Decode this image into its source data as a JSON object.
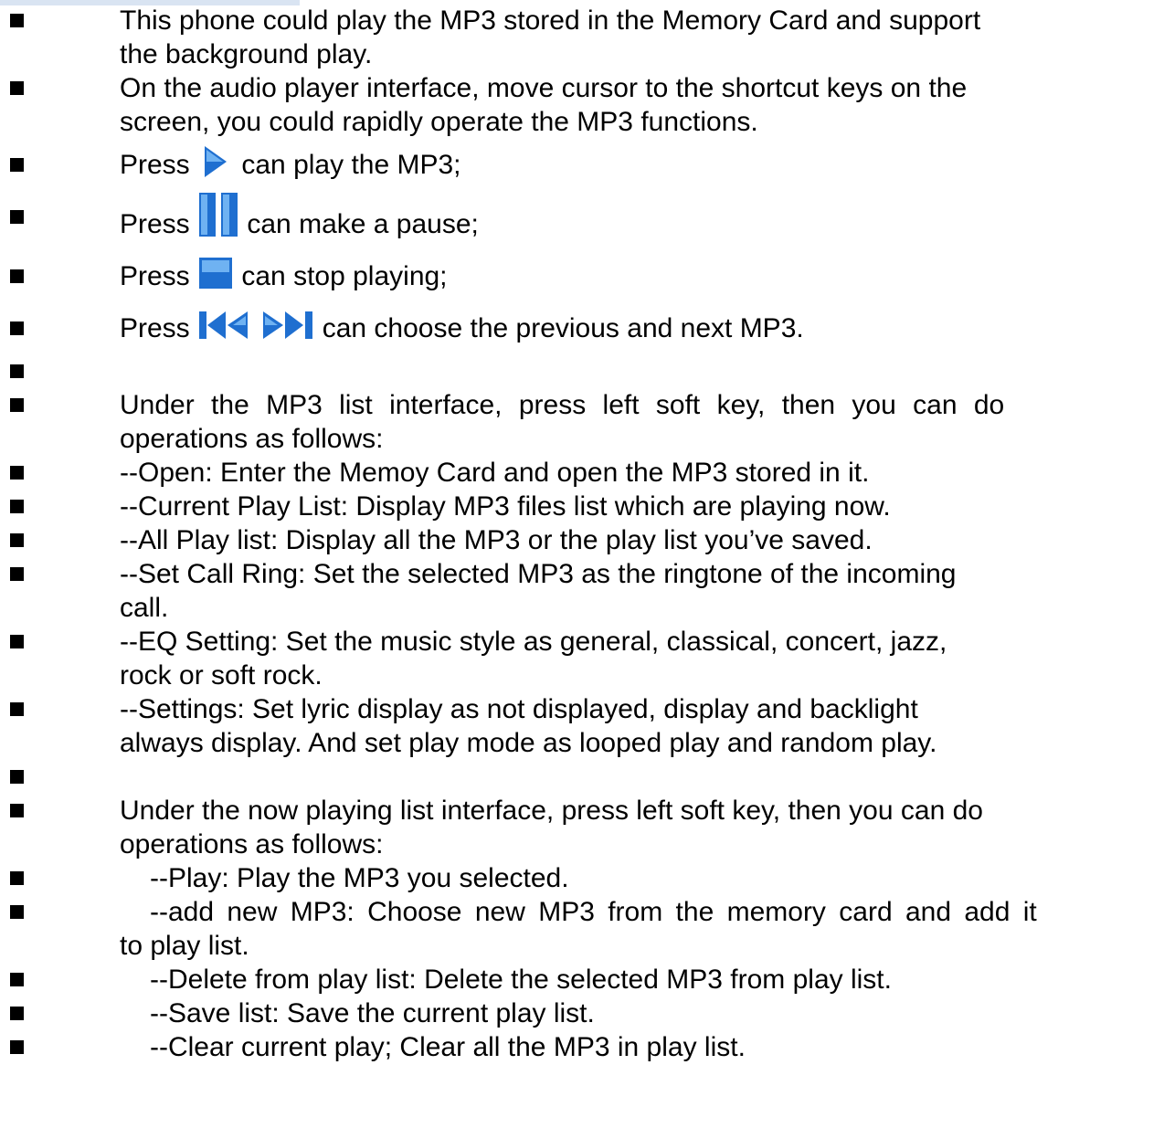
{
  "items": [
    {
      "a": "This phone could play the MP3 stored in the Memory Card and support",
      "b": "the background play."
    },
    {
      "a": "On the audio player interface, move cursor to the shortcut keys on the",
      "b": "screen, you could rapidly operate the MP3 functions."
    },
    {
      "pre": "Press",
      "post": "can play the MP3;",
      "icon": "play-icon"
    },
    {
      "pre": "Press",
      "post": "can make a pause;",
      "icon": "pause-icon"
    },
    {
      "pre": "Press",
      "post": "can stop playing;",
      "icon": "stop-icon"
    },
    {
      "pre": "Press",
      "post": "can choose the previous and next MP3.",
      "icon": "previous-next-icons"
    },
    {
      "a": "Under the MP3 list interface, press left soft key, then you can do",
      "b": "operations as follows:"
    },
    {
      "a": "--Open: Enter the Memoy Card and open the MP3 stored in it."
    },
    {
      "a": "--Current Play List: Display MP3 files list which are playing now."
    },
    {
      "a": "--All Play list: Display all the MP3 or the play list you’ve saved."
    },
    {
      "a": "--Set Call Ring: Set the selected MP3 as the ringtone of the incoming",
      "b": "call."
    },
    {
      "a": "--EQ Setting: Set the music style as general, classical, concert, jazz,",
      "b": "rock or soft rock."
    },
    {
      "a": "--Settings: Set lyric display as not displayed, display and backlight",
      "b": "always display. And set play mode as looped play and random play."
    },
    {
      "a": "Under the now playing list interface, press left soft key, then you can do",
      "b": "operations as follows:"
    },
    {
      "a": "--Play: Play the MP3 you selected."
    },
    {
      "a": "--add new MP3: Choose new MP3 from the memory card and add it",
      "b": "to play list."
    },
    {
      "a": "--Delete from play list: Delete the selected MP3 from play list."
    },
    {
      "a": "--Save list: Save the current play list."
    },
    {
      "a": "--Clear current play; Clear all the MP3 in play list."
    }
  ],
  "colors": {
    "icon_blue": "#1f6fd0",
    "icon_light": "#6fb2f2"
  }
}
